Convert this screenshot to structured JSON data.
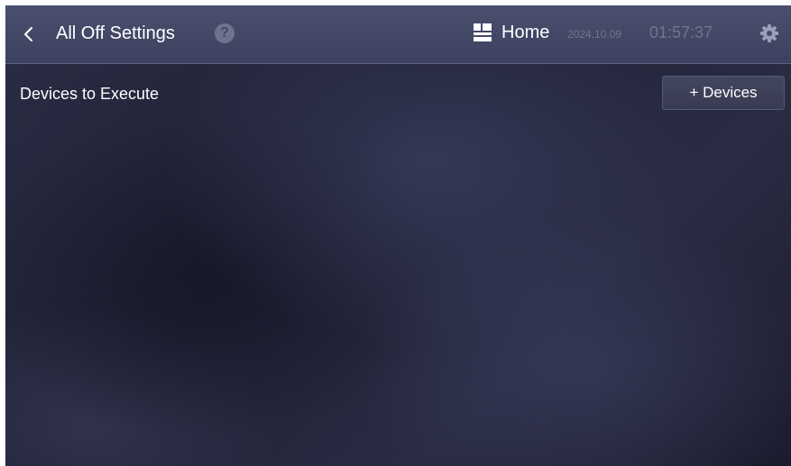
{
  "header": {
    "title": "All Off Settings",
    "help_icon": "question-mark-icon",
    "help_glyph": "?",
    "home_icon": "home-layout-icon",
    "home_label": "Home",
    "date": "2024.10.09",
    "time": "01:57:37",
    "settings_icon": "gear-icon"
  },
  "main": {
    "section_label": "Devices to Execute",
    "add_button_label": "+ Devices"
  },
  "colors": {
    "topbar": "#454a69",
    "background": "#23253a",
    "text": "#ffffff",
    "muted_text": "#6f7490"
  }
}
